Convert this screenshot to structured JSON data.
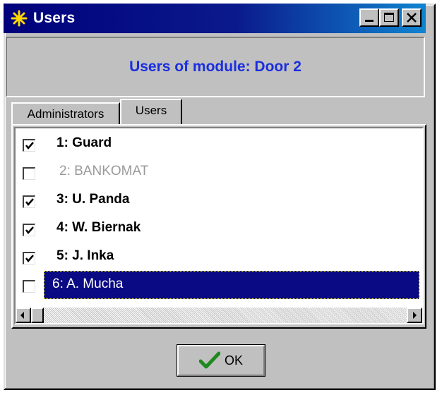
{
  "window": {
    "title": "Users",
    "icon": "asterisk-icon",
    "buttons": [
      "minimize",
      "maximize",
      "close"
    ]
  },
  "header": {
    "text": "Users of module: Door 2",
    "color": "#1a2ee0"
  },
  "tabs": [
    {
      "label": "Administrators",
      "active": false
    },
    {
      "label": "Users",
      "active": true
    }
  ],
  "users": [
    {
      "label": "1: Guard",
      "checked": true,
      "enabled": true,
      "selected": false
    },
    {
      "label": "2: BANKOMAT",
      "checked": false,
      "enabled": false,
      "selected": false
    },
    {
      "label": "3: U. Panda",
      "checked": true,
      "enabled": true,
      "selected": false
    },
    {
      "label": "4: W. Biernak",
      "checked": true,
      "enabled": true,
      "selected": false
    },
    {
      "label": "5: J. Inka",
      "checked": true,
      "enabled": true,
      "selected": false
    },
    {
      "label": "6: A. Mucha",
      "checked": false,
      "enabled": false,
      "selected": true
    }
  ],
  "ok_button": {
    "label": "OK",
    "icon": "checkmark-icon"
  },
  "colors": {
    "titlebar": "#00007b",
    "selection": "#0a0a84",
    "checkmark": "#1e8a1e"
  }
}
